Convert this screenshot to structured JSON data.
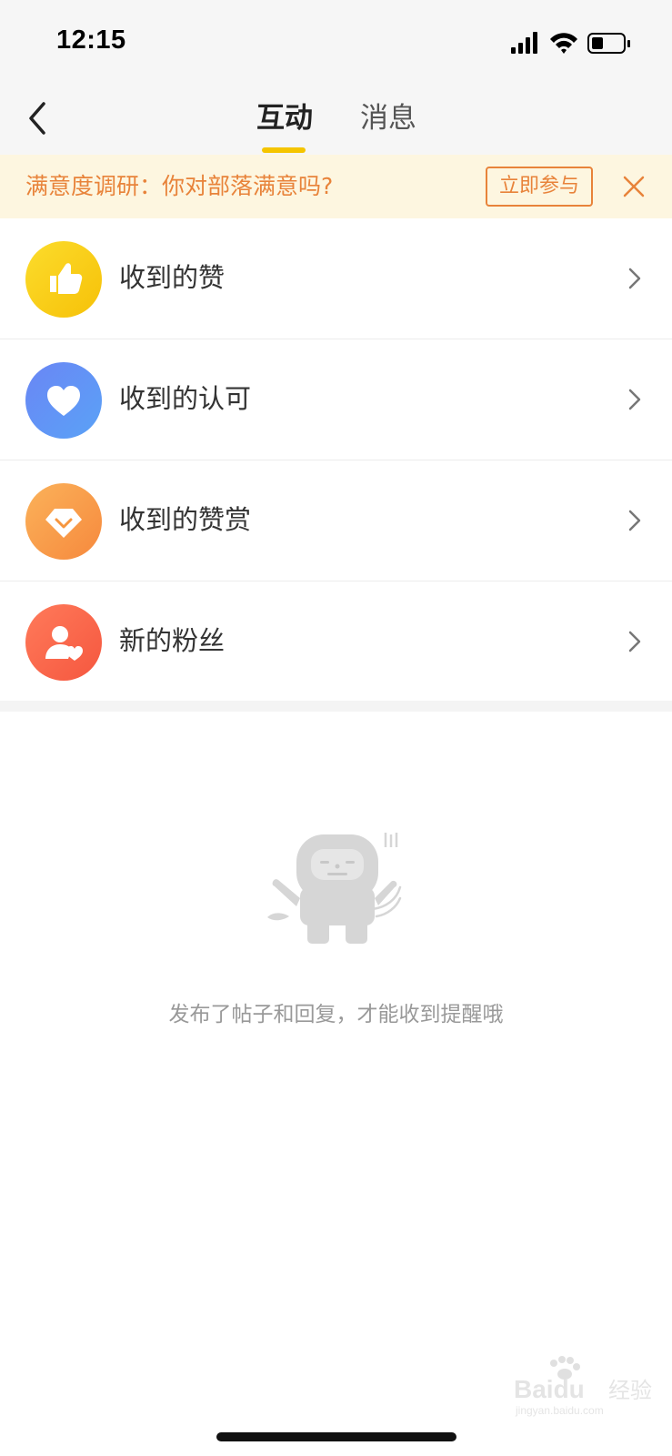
{
  "status_bar": {
    "time": "12:15"
  },
  "nav": {
    "tabs": [
      {
        "label": "互动",
        "active": true
      },
      {
        "label": "消息",
        "active": false
      }
    ],
    "accent_color": "#f5c500",
    "highlight_color": "#e8101a"
  },
  "survey": {
    "text": "满意度调研：你对部落满意吗?",
    "button_label": "立即参与",
    "color": "#e8833a"
  },
  "list": {
    "items": [
      {
        "label": "收到的赞",
        "icon": "thumbs-up-icon"
      },
      {
        "label": "收到的认可",
        "icon": "heart-icon"
      },
      {
        "label": "收到的赞赏",
        "icon": "diamond-icon"
      },
      {
        "label": "新的粉丝",
        "icon": "user-heart-icon"
      }
    ]
  },
  "empty_state": {
    "message": "发布了帖子和回复，才能收到提醒哦"
  },
  "watermark": {
    "brand": "Baidu",
    "suffix": "经验",
    "url": "jingyan.baidu.com"
  }
}
